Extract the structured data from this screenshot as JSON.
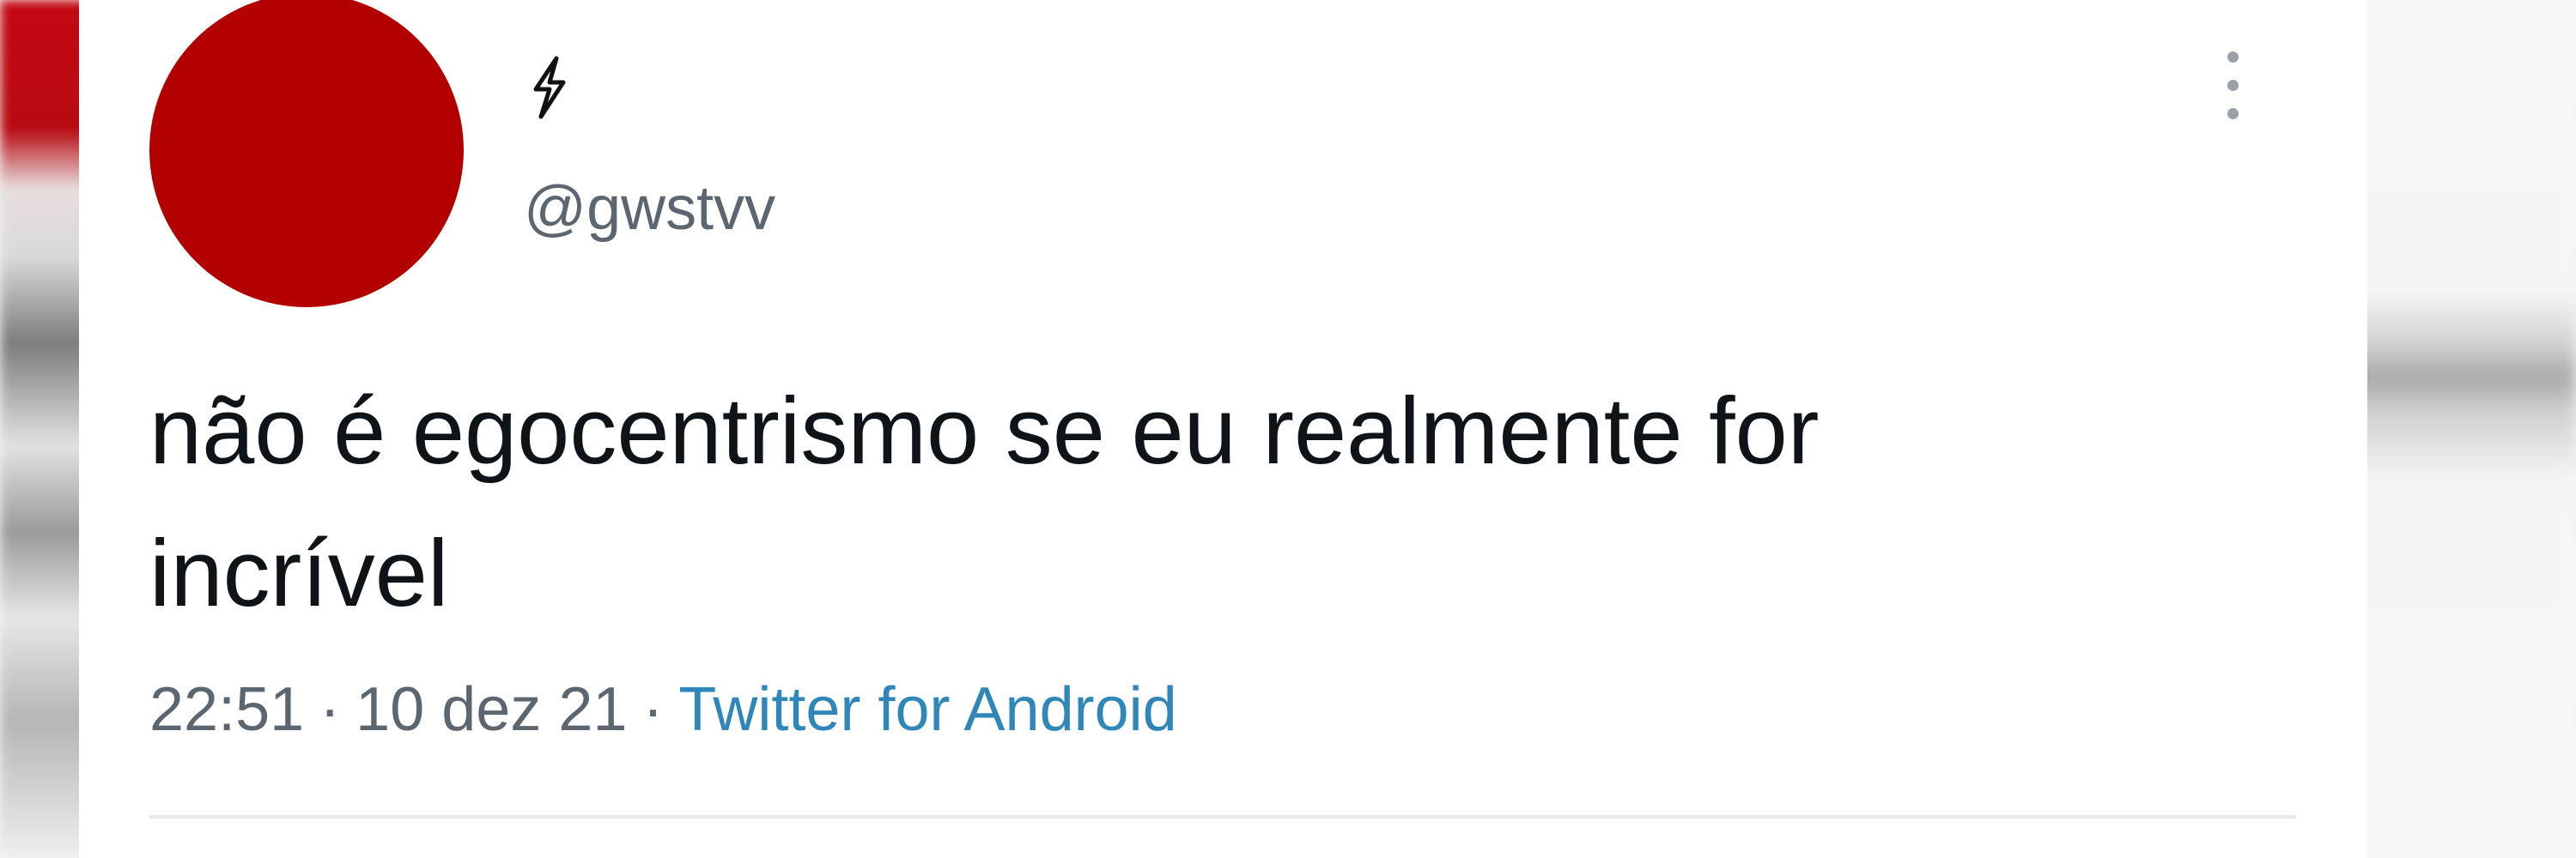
{
  "tweet": {
    "author": {
      "display_name": "⚡",
      "handle": "@gwstvv",
      "avatar_color": "#b30000"
    },
    "text_line1": "não é egocentrismo se eu realmente for",
    "text_line2": "incrível",
    "time": "22:51",
    "separator": "·",
    "date": "10 dez 21",
    "source": "Twitter for Android",
    "menu_icon": "more-vertical-icon"
  },
  "colors": {
    "text_primary": "#0f1419",
    "text_secondary": "#5b6670",
    "link": "#2f86b8"
  }
}
